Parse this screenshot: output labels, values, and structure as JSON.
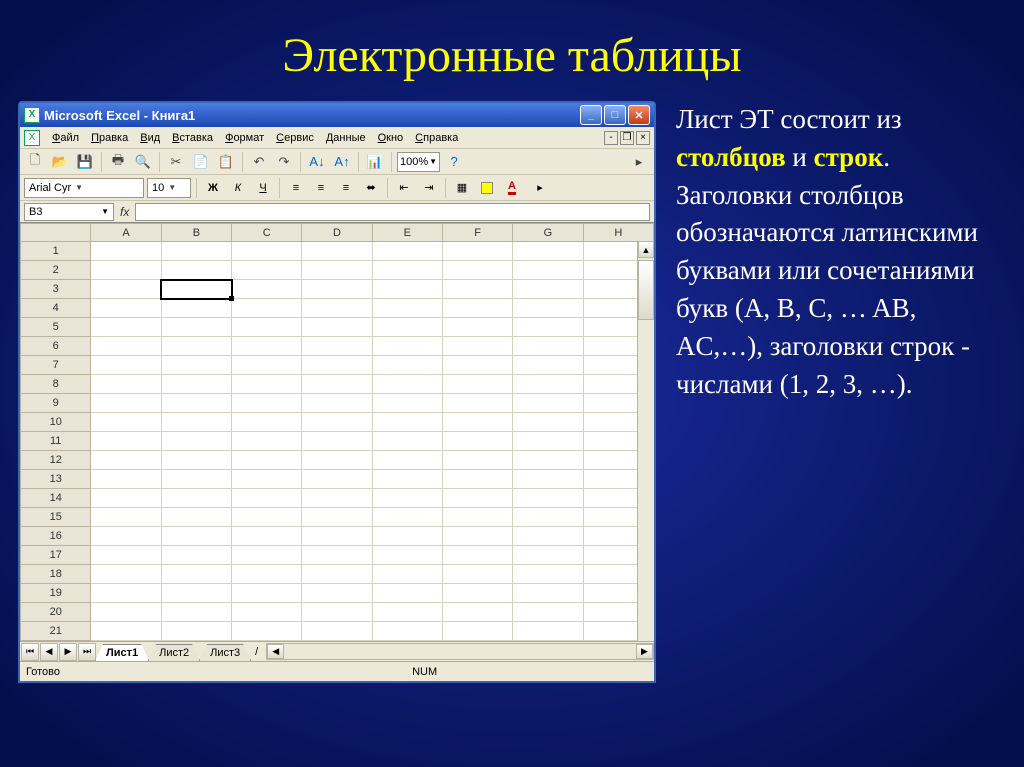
{
  "slide": {
    "title": "Электронные таблицы"
  },
  "window": {
    "title": "Microsoft Excel - Книга1",
    "app_icon": "X"
  },
  "menubar": {
    "icon": "X",
    "items": [
      "Файл",
      "Правка",
      "Вид",
      "Вставка",
      "Формат",
      "Сервис",
      "Данные",
      "Окно",
      "Справка"
    ]
  },
  "toolbar": {
    "zoom": "100%"
  },
  "format": {
    "font_name": "Arial Cyr",
    "font_size": "10",
    "bold": "Ж",
    "italic": "К",
    "underline": "Ч"
  },
  "formula": {
    "name_box": "B3",
    "fx": "fx"
  },
  "grid": {
    "cols": [
      "A",
      "B",
      "C",
      "D",
      "E",
      "F",
      "G",
      "H"
    ],
    "rows": [
      "1",
      "2",
      "3",
      "4",
      "5",
      "6",
      "7",
      "8",
      "9",
      "10",
      "11",
      "12",
      "13",
      "14",
      "15",
      "16",
      "17",
      "18",
      "19",
      "20",
      "21"
    ],
    "active_cell": "B3"
  },
  "tabs": {
    "active": "Лист1",
    "others": [
      "Лист2",
      "Лист3"
    ]
  },
  "status": {
    "ready": "Готово",
    "num": "NUM"
  },
  "side": {
    "p1a": "Лист ЭТ состоит из ",
    "p1b": "столбцов",
    "p1c": " и ",
    "p1d": "строк",
    "p1e": ". Заголовки столбцов обозначаются латинскими буквами или сочетаниями букв (A, B, C, … AB, AC,…), заголовки строк  - числами (1, 2, 3, …)."
  }
}
